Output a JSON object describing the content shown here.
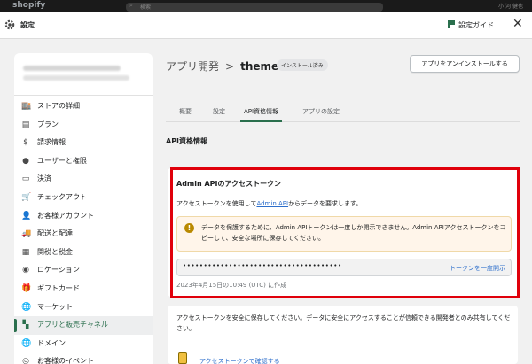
{
  "top": {
    "logo": "shopify",
    "search_placeholder": "検索",
    "user": "小 河 健也"
  },
  "window": {
    "title": "設定",
    "guide_label": "設定ガイド"
  },
  "sidebar": {
    "items": [
      {
        "label": "ストアの詳細",
        "icon": "store-icon",
        "glyph": "🏬"
      },
      {
        "label": "プラン",
        "icon": "plan-icon",
        "glyph": "▤"
      },
      {
        "label": "請求情報",
        "icon": "billing-icon",
        "glyph": "$"
      },
      {
        "label": "ユーザーと権限",
        "icon": "user-icon",
        "glyph": "●"
      },
      {
        "label": "決済",
        "icon": "payment-icon",
        "glyph": "▭"
      },
      {
        "label": "チェックアウト",
        "icon": "cart-icon",
        "glyph": "🛒"
      },
      {
        "label": "お客様アカウント",
        "icon": "customer-icon",
        "glyph": "👤"
      },
      {
        "label": "配送と配達",
        "icon": "truck-icon",
        "glyph": "🚚"
      },
      {
        "label": "関税と税金",
        "icon": "tax-icon",
        "glyph": "▦"
      },
      {
        "label": "ロケーション",
        "icon": "location-icon",
        "glyph": "◉"
      },
      {
        "label": "ギフトカード",
        "icon": "gift-icon",
        "glyph": "🎁"
      },
      {
        "label": "マーケット",
        "icon": "globe-icon",
        "glyph": "🌐"
      },
      {
        "label": "アプリと販売チャネル",
        "icon": "apps-icon",
        "glyph": "▚",
        "active": true
      },
      {
        "label": "ドメイン",
        "icon": "domain-icon",
        "glyph": "🌐"
      },
      {
        "label": "お客様のイベント",
        "icon": "event-icon",
        "glyph": "◎"
      }
    ]
  },
  "header": {
    "crumb_parent": "アプリ開発",
    "crumb_sep": ">",
    "crumb_current": "themekit",
    "badge": "インストール済み",
    "uninstall_label": "アプリをアンインストールする"
  },
  "tabs": [
    {
      "label": "概要"
    },
    {
      "label": "設定"
    },
    {
      "label": "API資格情報",
      "active": true
    },
    {
      "label": "アプリの設定"
    }
  ],
  "section_title": "API資格情報",
  "token_card": {
    "title": "Admin APIのアクセストークン",
    "desc_prefix": "アクセストークンを使用して",
    "desc_link": "Admin API",
    "desc_suffix": "からデータを要求します。",
    "warning": "データを保護するために、Admin APIトークンは一度しか開示できません。Admin APIアクセストークンをコピーして、安全な場所に保存してください。",
    "token_mask": "••••••••••••••••••••••••••••••••••••••",
    "reveal_label": "トークンを一度開示",
    "created": "2023年4月15日の10:49 (UTC) に作成"
  },
  "info_card": {
    "text": "アクセストークンを安全に保存してください。データに安全にアクセスすることが信頼できる開発者とのみ共有してください。",
    "link": "アクセストークンで確認する"
  }
}
